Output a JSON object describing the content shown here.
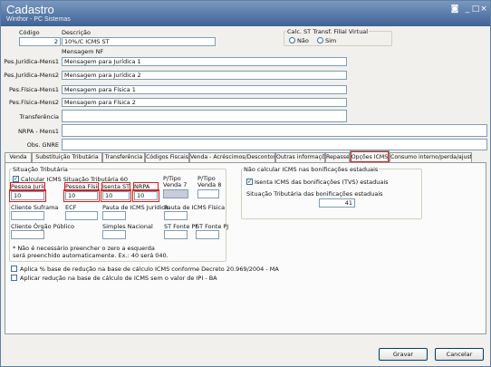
{
  "window": {
    "title": "Cadastro",
    "subtitle": "Winthor - PC Sistemas",
    "controls": [
      "◙",
      "_",
      "□",
      "×"
    ]
  },
  "header": {
    "code_label": "Código",
    "code_value": "2",
    "desc_label": "Descrição",
    "desc_value": "10%/C ICMS ST",
    "nf_msg_label": "Mensagem NF",
    "virtual_label": "Calc. ST Transf. Filial Virtual",
    "virtual_no": "Não",
    "virtual_yes": "Sim"
  },
  "messages": [
    {
      "label": "Pes.Jurídica-Mens1",
      "value": "Mensagem para Jurídica 1"
    },
    {
      "label": "Pes.Jurídica-Mens2",
      "value": "Mensagem para Jurídica 2"
    },
    {
      "label": "Pes.Física-Mens1",
      "value": "Mensagem para Física 1"
    },
    {
      "label": "Pes.Física-Mens2",
      "value": "Mensagem para Física 2"
    },
    {
      "label": "Transferência",
      "value": ""
    },
    {
      "label": "NRPA - Mens1",
      "value": ""
    },
    {
      "label": "Obs. GNRE",
      "value": ""
    }
  ],
  "tabs": [
    "Venda",
    "Substituição Tributária",
    "Transferência",
    "Códigos Fiscais",
    "Venda - Acréscimos/Descontos",
    "Outras informações",
    "Repasse",
    "Opções ICMS",
    "Consumo interno/perda/ajuste"
  ],
  "icms": {
    "situacao_group": "Situação Tributária",
    "calcular_label": "Calcular ICMS Situação Tributária 60",
    "fields_row1": [
      {
        "label": "Pessoa Jurídica*",
        "value": "10"
      },
      {
        "label": "Pessoa Física*",
        "value": "10"
      },
      {
        "label": "Isenta ST",
        "value": "10"
      },
      {
        "label": "NRPA",
        "value": "10"
      }
    ],
    "pt7_label1": "P/Tipo",
    "pt7_label2": "Venda 7",
    "pt8_label1": "P/Tipo",
    "pt8_label2": "Venda 8",
    "row2_labels": [
      "Cliente Suframa",
      "ECF",
      "Pauta de ICMS Jurídica",
      "Pauta de ICMS Física"
    ],
    "row3_labels": [
      "Cliente Órgão Público",
      "Simples Nacional",
      "ST Fonte PF",
      "ST Fonte PJ"
    ],
    "note1": "* Não é necessário preencher o zero a esquerda",
    "note2": "será preenchido automaticamente. Ex.: 40 será 040.",
    "bonif_group": "Não calcular ICMS nas bonificações estaduais",
    "isenta_label": "Isenta ICMS das bonificações (TVS) estaduais",
    "sit_bonif_label": "Situação Tributária das bonificações estaduais",
    "sit_bonif_value": "41",
    "aplica_label": "Aplica % base de redução na base de cálculo ICMS conforme Decreto 20.969/2004 - MA",
    "aplicar_label": "Aplicar redução na base de cálculo de ICMS sem o valor de IPI - BA"
  },
  "buttons": {
    "save": "Gravar",
    "cancel": "Cancelar"
  }
}
